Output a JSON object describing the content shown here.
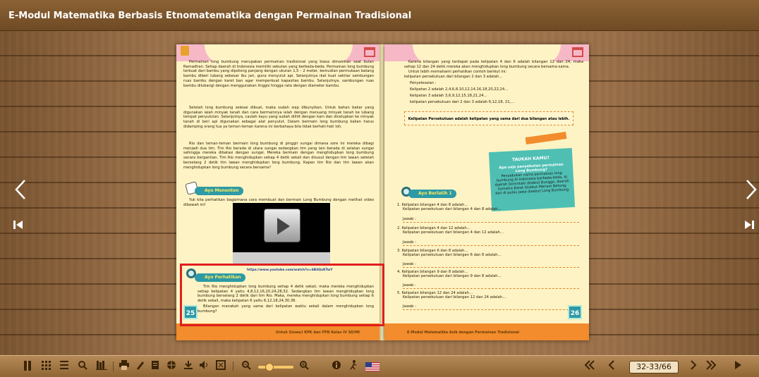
{
  "window": {
    "title": "E-Modul Matematika Berbasis Etnomatematika dengan Permainan Tradisional"
  },
  "left_page": {
    "intro": "Permainan long bumbung merupakan permainan tradisional yang biasa dimainkan saat bulan Ramadhan. Setiap daerah di Indonesia memiliki sebutan yang berbeda-beda. Permainan long bumbung terbuat dari bambu yang dipotong panjang dengan ukuran 1,5 – 2 meter, kemudian permukaan batang bambu diberi lubang sebesar ibu jari, guna menyulut api. Selanjutnya ikat kuat sekitar sambungan ruas bambu dengan karet ban agar memperkuat kapasitas bambu. Selanjutnya, sambungan ruas bambu dilubangi dengan menggunakan linggis hingga rata dengan diameter bambu.",
    "para2": "Setelah long bumbung selesai dibuat, maka sudah siap dibunyikan. Untuk bahan bakar yang digunakan ialah minyak tanah dan cara bermainnya ialah dengan menuang minyak tanah ke lubang tempat penyulutan. Selanjutnya, caulah kayu yang sudah dilitit dengan kain dan dicelupkan ke minyak tanah di beri api digunakan sebagai alat penyulut. Dalam bermain long bumbung kalian harus didamping orang tua ya teman-teman karena ini berbahaya bila tidak berhati-hati loh.",
    "para3": "Rio dan teman-teman bermain long bumbung di pinggir sungai dimana sore ini mereka dibagi menjadi dua tim. Tim Rio berada di utara sungai sedangkan tim yang lain berada di selatan sungai sehingga mereka dibatasi dengan sungai. Mereka bermain dengan menghidupkan long bumbung secara bergantian. Tim Rio menghidupkan setiap 4 detik sekali dan disusul dengan tim lawan setelah berselang 2 detik tim lawan menghidupkan long bumbung. Kapan tim Rio dan tim lawan akan menghidupkan long bumbung secara bersama?",
    "menonton_title": "Ayo Menonton",
    "menonton_text": "Yuk kita perhatikan bagaimana cara membuat dan bermain Long Bumbung dengan melihat video dibawah ini!",
    "video_link": "https://www.youtube.com/watch?v=6B3QxKTwY",
    "perhatikan_title": "Ayo Perhatikan",
    "perhatikan_text": "Tim Rio menghidupkan long bumbung setiap 4 detik sekali, maka mereka menghidupkan setiap kelipatan 4 yaitu 4,8,12,16,20,24,28,32. Sedangkan tim lawan menghidupkan long bumbung berselang 2 detik dari tim Rio. Maka, mereka menghidupkan long bumbung setiap 6 detik sekali, maka kelipatan 6 yaitu 6,12,18,24,30,36.",
    "perhatikan_q": "Bilangan manakah yang sama dari kelipatan waktu sekali dalam menghidupkan long bumbung?",
    "page_number": "25",
    "footer": "Untuk Siswa/i KPK dan FPB Kelas IV SD/MI"
  },
  "right_page": {
    "l1": "Karena bilangan yang terdapat pada kelipatan 4 dan 6 adalah bilangan 12 dan 24, maka setiap 12 dan 24 detik mereka akan menghidupkan long bumbung secara bersama-sama.",
    "l2": "Untuk lebih memahami perhatikan contoh berikut ini:",
    "l3": "kelipatan persekutuan dari bilangan 2 dan 3 adalah…",
    "l4": "Penyelesaian :",
    "l5": "Kelipatan 2 adalah 2,4,6,8,10,12,14,16,18,20,22,24…",
    "l6": "Kelipatan 3 adalah 3,6,9,12,15,18,21,24…",
    "l7": "kelipatan persekutuan dari 2 dan 3 adalah 6,12,18, 21,…",
    "definition": "Kelipatan Persekutuan adalah kelipatan yang sama dari dua bilangan atau lebih.",
    "tahu_title": "TAUKAH KAMU?",
    "tahu_q": "Apa saja penyebutan permainan Long Bumbung?",
    "tahu_a": "Penyebutan nama permainan long bumbung di Indonesia berbeda-beda, di daerah Gorontalo disebut Bunggo, daerah Sumatra Barat disebut Meriam Betung, dan di pulau Jawa disebut Long Bumbung.",
    "berlatih_title": "Ayo Berlatih 1",
    "exercises": [
      {
        "q": "1. Kelipatan bilangan 4 dan 8 adalah…",
        "s": "Kelipatan persekutuan dari bilangan 4 dan 8 adalah…"
      },
      {
        "q": "2. Kelipatan bilangan 4 dan 12 adalah…",
        "s": "Kelipatan persekutuan dari bilangan 4 dan 12 adalah…"
      },
      {
        "q": "3. Kelipatan bilangan 6 dan 8 adalah…",
        "s": "Kelipatan persekutuan dari bilangan 6 dan 8 adalah…"
      },
      {
        "q": "4. Kelipatan bilangan 9 dan 8 adalah…",
        "s": "Kelipatan persekutuan dari bilangan 9 dan 8 adalah…"
      },
      {
        "q": "5. Kelipatan bilangan 12 dan 24 adalah…",
        "s": "Kelipatan persekutuan dari bilangan 12 dan 24 adalah…"
      }
    ],
    "jawab": "Jawab :",
    "page_number": "26",
    "footer": "E-Modul Matematika Asik dengan Permainan Tradisional"
  },
  "toolbar": {
    "page_indicator": "32-33/66"
  },
  "icons": {
    "prev": "chevron-left-icon",
    "next": "chevron-right-icon",
    "first": "first-page-icon",
    "last": "last-page-icon"
  }
}
